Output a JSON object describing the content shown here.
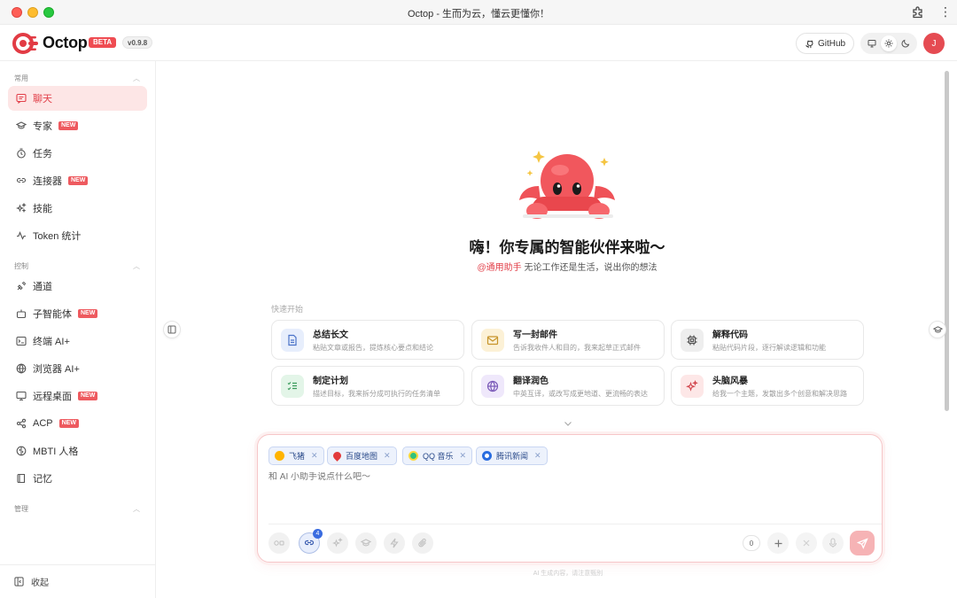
{
  "window": {
    "title": "Octop - 生而为云，懂云更懂你！"
  },
  "header": {
    "brand": "Octop",
    "beta": "BETA",
    "version": "v0.9.8",
    "github_label": "GitHub",
    "avatar_initial": "J",
    "accent_color": "#e54b52"
  },
  "sidebar": {
    "groups": [
      {
        "label": "常用"
      },
      {
        "label": "控制"
      },
      {
        "label": "管理"
      }
    ],
    "items": [
      {
        "label": "聊天",
        "icon": "chat-icon",
        "active": true
      },
      {
        "label": "专家",
        "icon": "graduation-cap-icon",
        "badge": "NEW"
      },
      {
        "label": "任务",
        "icon": "timer-icon"
      },
      {
        "label": "连接器",
        "icon": "link-icon",
        "badge": "NEW"
      },
      {
        "label": "技能",
        "icon": "sparkles-icon"
      },
      {
        "label": "Token 统计",
        "icon": "activity-icon"
      },
      {
        "label": "通道",
        "icon": "satellite-icon"
      },
      {
        "label": "子智能体",
        "icon": "bot-icon",
        "badge": "NEW"
      },
      {
        "label": "终端 AI+",
        "icon": "terminal-icon"
      },
      {
        "label": "浏览器 AI+",
        "icon": "globe-icon"
      },
      {
        "label": "远程桌面",
        "icon": "monitor-icon",
        "badge": "NEW"
      },
      {
        "label": "ACP",
        "icon": "share-icon",
        "badge": "NEW"
      },
      {
        "label": "MBTI 人格",
        "icon": "brain-icon"
      },
      {
        "label": "记忆",
        "icon": "book-icon"
      }
    ],
    "collapse_label": "收起"
  },
  "hero": {
    "title": "嗨！你专属的智能伙伴来啦～",
    "mention": "@通用助手",
    "subtitle": "无论工作还是生活，说出你的想法"
  },
  "quick_start": {
    "label": "快速开始",
    "cards": [
      {
        "title": "总结长文",
        "desc": "粘贴文章或报告，提炼核心要点和结论",
        "icon": "document-icon",
        "color": "#e7eefc"
      },
      {
        "title": "写一封邮件",
        "desc": "告诉我收件人和目的，我来起草正式邮件",
        "icon": "mail-icon",
        "color": "#fcf1d6"
      },
      {
        "title": "解释代码",
        "desc": "粘贴代码片段，逐行解读逻辑和功能",
        "icon": "chip-icon",
        "color": "#eeeeee"
      },
      {
        "title": "制定计划",
        "desc": "描述目标，我来拆分成可执行的任务清单",
        "icon": "checklist-icon",
        "color": "#e3f5e8"
      },
      {
        "title": "翻译润色",
        "desc": "中英互译，或改写成更地道、更流畅的表达",
        "icon": "globe-icon",
        "color": "#efe8fb"
      },
      {
        "title": "头脑风暴",
        "desc": "给我一个主题，发散出多个创意和解决思路",
        "icon": "sparkle-icon",
        "color": "#fde7e7"
      }
    ]
  },
  "composer": {
    "chips": [
      {
        "label": "飞猪",
        "icon": "fliggy-icon",
        "color": "#ffb400"
      },
      {
        "label": "百度地图",
        "icon": "map-pin-icon",
        "color": "#e23b3b"
      },
      {
        "label": "QQ 音乐",
        "icon": "qq-music-icon",
        "color": "#31c27c"
      },
      {
        "label": "腾讯新闻",
        "icon": "tencent-news-icon",
        "color": "#2a6de0"
      }
    ],
    "placeholder": "和 AI 小助手说点什么吧～",
    "link_count": "4",
    "char_count": "0"
  },
  "disclaimer": "AI 生成内容，请注意甄别"
}
